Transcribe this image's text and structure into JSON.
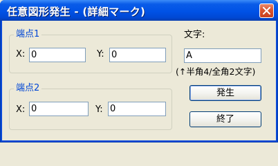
{
  "window": {
    "title": "任意図形発生 - (詳細マーク)"
  },
  "point1": {
    "legend": "端点1",
    "x_label": "X:",
    "x_value": "0",
    "y_label": "Y:",
    "y_value": "0"
  },
  "point2": {
    "legend": "端点2",
    "x_label": "X:",
    "x_value": "0",
    "y_label": "Y:",
    "y_value": "0"
  },
  "text": {
    "label": "文字:",
    "value": "A",
    "hint": "(↑半角4/全角2文字)"
  },
  "buttons": {
    "generate": "発生",
    "exit": "終了"
  },
  "icons": {
    "close": "close-icon"
  }
}
